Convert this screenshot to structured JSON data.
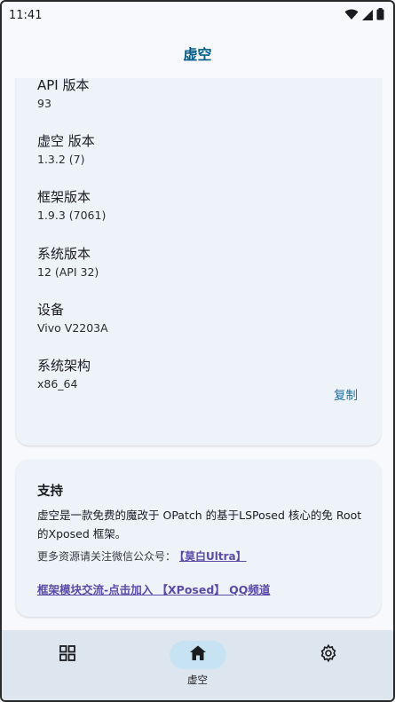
{
  "status_bar": {
    "time": "11:41"
  },
  "top_bar": {
    "title": "虚空"
  },
  "info": {
    "items": [
      {
        "label": "API 版本",
        "value": "93"
      },
      {
        "label": "虚空 版本",
        "value": "1.3.2 (7)"
      },
      {
        "label": "框架版本",
        "value": "1.9.3 (7061)"
      },
      {
        "label": "系统版本",
        "value": "12 (API 32)"
      },
      {
        "label": "设备",
        "value": "Vivo V2203A"
      },
      {
        "label": "系统架构",
        "value": "x86_64"
      }
    ],
    "copy_label": "复制"
  },
  "support": {
    "title": "支持",
    "description": "虚空是一款免费的魔改于 OPatch 的基于LSPosed 核心的免 Root 的Xposed 框架。",
    "wechat_prefix": "更多资源请关注微信公众号：",
    "wechat_link": "【莫白Ultra】",
    "channel_link": "框架模块交流-点击加入 【XPosed】 QQ频道"
  },
  "nav": {
    "items": [
      {
        "label": "",
        "icon": "modules-icon"
      },
      {
        "label": "虚空",
        "icon": "home-icon"
      },
      {
        "label": "",
        "icon": "gear-icon"
      }
    ]
  },
  "colors": {
    "accent": "#005b86",
    "link": "#5b4aa8",
    "nav_bg": "#dde6ee",
    "card_bg": "#eef2f9"
  }
}
